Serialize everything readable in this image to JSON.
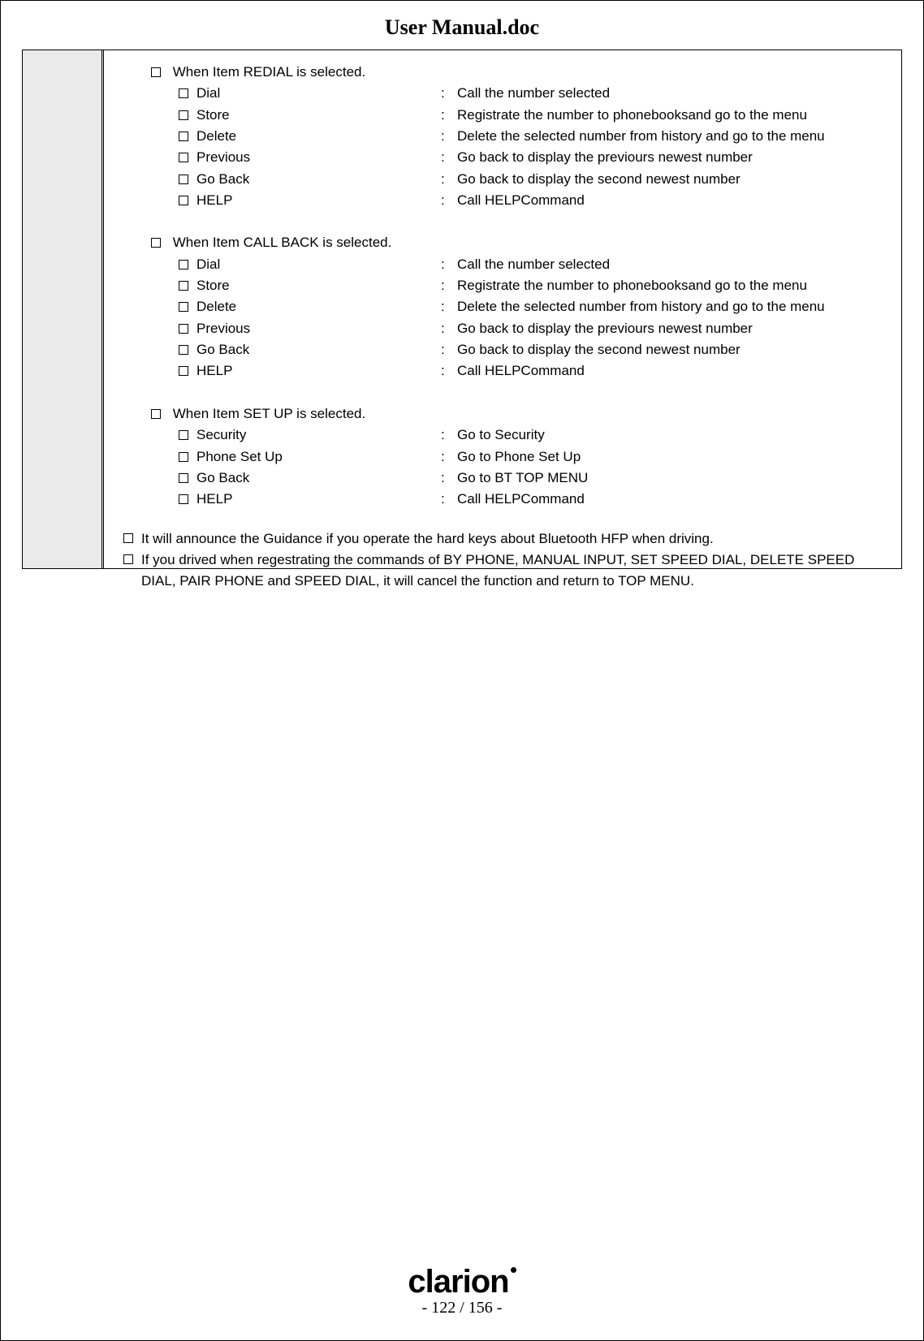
{
  "title": "User Manual.doc",
  "sections": [
    {
      "header": "When Item REDIAL is selected.",
      "items": [
        {
          "label": "Dial",
          "desc": "Call the number selected"
        },
        {
          "label": "Store",
          "desc": "Registrate the number to phonebooksand go to the menu"
        },
        {
          "label": "Delete",
          "desc": "Delete the selected number from history and go to the menu"
        },
        {
          "label": "Previous",
          "desc": "Go back to display the previours newest number"
        },
        {
          "label": "Go Back",
          "desc": "Go back to display the second newest number"
        },
        {
          "label": "HELP",
          "desc": "Call HELPCommand"
        }
      ]
    },
    {
      "header": "When Item CALL BACK is selected.",
      "items": [
        {
          "label": "Dial",
          "desc": "Call the number selected"
        },
        {
          "label": "Store",
          "desc": "Registrate the number to phonebooksand go to the menu"
        },
        {
          "label": "Delete",
          "desc": "Delete the selected number from history and go to the menu"
        },
        {
          "label": "Previous",
          "desc": "Go back to display the previours newest number"
        },
        {
          "label": "Go Back",
          "desc": "Go back to display the second newest number"
        },
        {
          "label": "HELP",
          "desc": "Call HELPCommand"
        }
      ]
    },
    {
      "header": "When Item SET UP is selected.",
      "items": [
        {
          "label": "Security",
          "desc": "Go to Security"
        },
        {
          "label": "Phone Set Up",
          "desc": "Go to Phone Set Up"
        },
        {
          "label": "Go Back",
          "desc": "Go to BT TOP MENU"
        },
        {
          "label": "HELP",
          "desc": "Call HELPCommand"
        }
      ]
    }
  ],
  "notes": [
    "It will announce the Guidance if you operate the hard keys about Bluetooth HFP when driving.",
    "If you drived when regestrating the commands of BY PHONE, MANUAL INPUT, SET SPEED DIAL, DELETE SPEED DIAL, PAIR PHONE and SPEED DIAL, it will cancel the function and return to TOP MENU."
  ],
  "footer": {
    "brand": "clarion",
    "pager": "- 122 / 156 -"
  }
}
